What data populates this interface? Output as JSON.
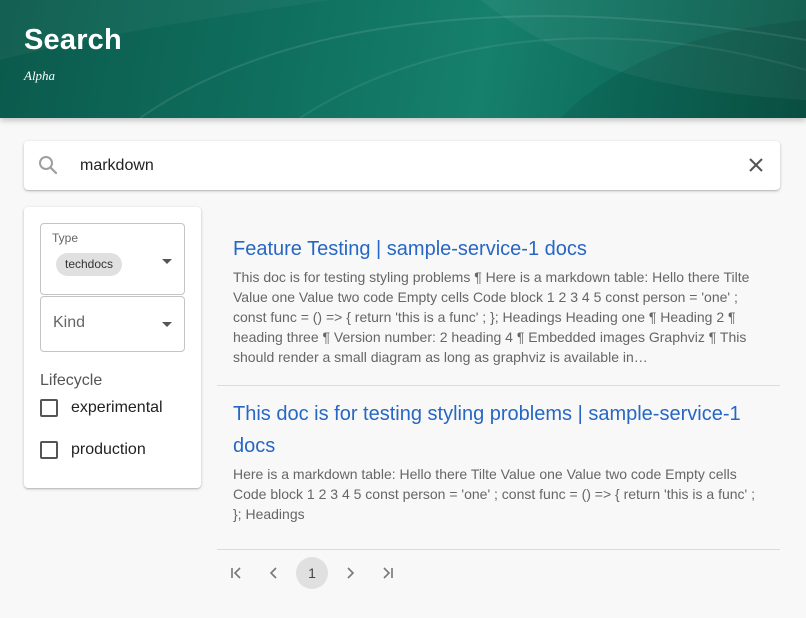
{
  "header": {
    "title": "Search",
    "subtitle": "Alpha"
  },
  "search": {
    "value": "markdown",
    "search_icon": "search-icon",
    "clear_icon": "close-icon"
  },
  "filters": {
    "type": {
      "label": "Type",
      "chip": "techdocs"
    },
    "kind": {
      "label": "Kind"
    },
    "lifecycle": {
      "label": "Lifecycle",
      "options": [
        {
          "label": "experimental",
          "checked": false
        },
        {
          "label": "production",
          "checked": false
        }
      ]
    }
  },
  "results": [
    {
      "title": "Feature Testing | sample-service-1 docs",
      "text": "This doc is for testing styling problems ¶ Here is a markdown table: Hello there Tilte Value one Value two code Empty cells Code block 1 2 3 4 5 const person = 'one' ; const func = () => { return 'this is a func' ; }; Headings Heading one ¶ Heading 2 ¶ heading three ¶ Version number: 2 heading 4 ¶ Embedded images Graphviz ¶ This should render a small diagram as long as graphviz is available in…"
    },
    {
      "title": "This doc is for testing styling problems | sample-service-1 docs",
      "text": "Here is a markdown table: Hello there Tilte Value one Value two code Empty cells Code block 1 2 3 4 5 const person = 'one' ; const func = () => { return 'this is a func' ; }; Headings"
    }
  ],
  "pagination": {
    "current_page": "1",
    "icons": [
      "first-page-icon",
      "prev-page-icon",
      "next-page-icon",
      "last-page-icon"
    ]
  },
  "colors": {
    "header": "#0f6f5e",
    "link": "#2767c4",
    "chip": "#e0e0e0"
  }
}
